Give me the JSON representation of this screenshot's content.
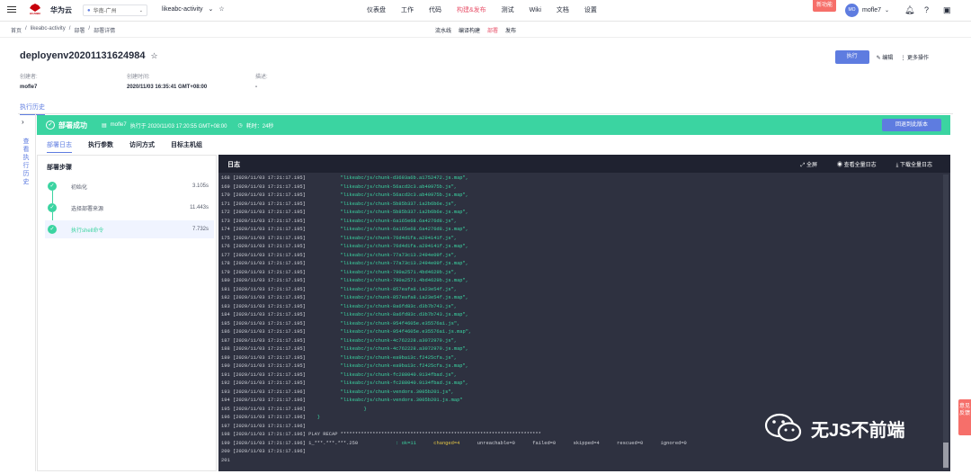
{
  "topbar": {
    "brand": "华为云",
    "logo_text": "HUAWEI",
    "region": "华南-广州",
    "project": "likeabc-activity",
    "nav": [
      "仪表盘",
      "工作",
      "代码",
      "构建&发布",
      "测试",
      "Wiki",
      "文档",
      "设置"
    ],
    "active_nav": 3,
    "new_badge": "新功能",
    "user_initials": "MO",
    "user": "mofle7"
  },
  "subnav": {
    "breadcrumb": [
      "首页",
      "/",
      "likeabc-activity",
      "/",
      "部署",
      "/",
      "部署详情"
    ],
    "tabs": [
      "流水线",
      "编译构建",
      "部署",
      "发布"
    ],
    "active_tab": 2
  },
  "page": {
    "title": "deployenv20201131624984",
    "run_label": "执行",
    "edit_label": "编辑",
    "more_label": "更多操作",
    "meta": [
      {
        "k": "创建者:",
        "v": "mofle7"
      },
      {
        "k": "创建时间:",
        "v": "2020/11/03 16:35:41 GMT+08:00"
      },
      {
        "k": "描述:",
        "v": "-"
      }
    ],
    "history_tab": "执行历史",
    "side_label": "查看执行历史"
  },
  "banner": {
    "status": "部署成功",
    "user": "mofle7",
    "exec_text": "执行于 2020/11/03 17:20:55 GMT+08:00",
    "duration": "耗时：24秒",
    "rollback": "回退到此版本"
  },
  "subtabs": [
    "部署日志",
    "执行参数",
    "访问方式",
    "目标主机组"
  ],
  "steps": {
    "title": "部署步骤",
    "items": [
      {
        "name": "初始化",
        "time": "3.105s"
      },
      {
        "name": "选择部署来源",
        "time": "11.443s"
      },
      {
        "name": "执行shell命令",
        "time": "7.732s"
      }
    ],
    "selected": 2
  },
  "log": {
    "title": "日志",
    "ops": [
      "全屏",
      "查看全量日志",
      "下载全量日志"
    ],
    "lines": [
      {
        "n": "168",
        "ts": "[2020/11/03 17:21:17.195]",
        "text": "\"likeabc/js/chunk-d3693a6b.a1752472.js.map\","
      },
      {
        "n": "169",
        "ts": "[2020/11/03 17:21:17.195]",
        "text": "\"likeabc/js/chunk-56acd2c3.ab40975b.js\","
      },
      {
        "n": "170",
        "ts": "[2020/11/03 17:21:17.195]",
        "text": "\"likeabc/js/chunk-56acd2c3.ab40975b.js.map\","
      },
      {
        "n": "171",
        "ts": "[2020/11/03 17:21:17.195]",
        "text": "\"likeabc/js/chunk-5b85b337.1a2b6b6e.js\","
      },
      {
        "n": "172",
        "ts": "[2020/11/03 17:21:17.195]",
        "text": "\"likeabc/js/chunk-5b85b337.1a2b6b6e.js.map\","
      },
      {
        "n": "173",
        "ts": "[2020/11/03 17:21:17.195]",
        "text": "\"likeabc/js/chunk-6a165e68.6a4276d8.js\","
      },
      {
        "n": "174",
        "ts": "[2020/11/03 17:21:17.195]",
        "text": "\"likeabc/js/chunk-6a165e68.6a4276d8.js.map\","
      },
      {
        "n": "175",
        "ts": "[2020/11/03 17:21:17.195]",
        "text": "\"likeabc/js/chunk-76d4d1fa.a294141f.js\","
      },
      {
        "n": "176",
        "ts": "[2020/11/03 17:21:17.195]",
        "text": "\"likeabc/js/chunk-76d4d1fa.a294141f.js.map\","
      },
      {
        "n": "177",
        "ts": "[2020/11/03 17:21:17.195]",
        "text": "\"likeabc/js/chunk-77a73c13.2494e09f.js\","
      },
      {
        "n": "178",
        "ts": "[2020/11/03 17:21:17.195]",
        "text": "\"likeabc/js/chunk-77a73c13.2494e09f.js.map\","
      },
      {
        "n": "179",
        "ts": "[2020/11/03 17:21:17.195]",
        "text": "\"likeabc/js/chunk-790a2571.4bd4629b.js\","
      },
      {
        "n": "180",
        "ts": "[2020/11/03 17:21:17.195]",
        "text": "\"likeabc/js/chunk-790a2571.4bd4629b.js.map\","
      },
      {
        "n": "181",
        "ts": "[2020/11/03 17:21:17.195]",
        "text": "\"likeabc/js/chunk-857eafa8.1a23e54f.js\","
      },
      {
        "n": "182",
        "ts": "[2020/11/03 17:21:17.195]",
        "text": "\"likeabc/js/chunk-857eafa8.1a23e54f.js.map\","
      },
      {
        "n": "183",
        "ts": "[2020/11/03 17:21:17.195]",
        "text": "\"likeabc/js/chunk-8a6fd83c.d3b7b743.js\","
      },
      {
        "n": "184",
        "ts": "[2020/11/03 17:21:17.195]",
        "text": "\"likeabc/js/chunk-8a6fd83c.d3b7b743.js.map\","
      },
      {
        "n": "185",
        "ts": "[2020/11/03 17:21:17.195]",
        "text": "\"likeabc/js/chunk-954f4605e.e35576a1.js\","
      },
      {
        "n": "186",
        "ts": "[2020/11/03 17:21:17.195]",
        "text": "\"likeabc/js/chunk-954f4605e.e35576a1.js.map\","
      },
      {
        "n": "187",
        "ts": "[2020/11/03 17:21:17.195]",
        "text": "\"likeabc/js/chunk-4c762228.a3072979.js\","
      },
      {
        "n": "188",
        "ts": "[2020/11/03 17:21:17.195]",
        "text": "\"likeabc/js/chunk-4c762228.a3072979.js.map\","
      },
      {
        "n": "189",
        "ts": "[2020/11/03 17:21:17.195]",
        "text": "\"likeabc/js/chunk-ea9ba13c.f2425cfa.js\","
      },
      {
        "n": "190",
        "ts": "[2020/11/03 17:21:17.195]",
        "text": "\"likeabc/js/chunk-ea9ba13c.f2425cfa.js.map\","
      },
      {
        "n": "191",
        "ts": "[2020/11/03 17:21:17.195]",
        "text": "\"likeabc/js/chunk-fc288040.9134fbad.js\","
      },
      {
        "n": "192",
        "ts": "[2020/11/03 17:21:17.195]",
        "text": "\"likeabc/js/chunk-fc288040.9134fbad.js.map\","
      },
      {
        "n": "193",
        "ts": "[2020/11/03 17:21:17.196]",
        "text": "\"likeabc/js/chunk-vendors.3005b201.js\","
      },
      {
        "n": "194",
        "ts": "[2020/11/03 17:21:17.196]",
        "text": "\"likeabc/js/chunk-vendors.3005b201.js.map\""
      },
      {
        "n": "195",
        "ts": "[2020/11/03 17:21:17.196]",
        "text": "}",
        "indent": 1
      },
      {
        "n": "196",
        "ts": "[2020/11/03 17:21:17.196]",
        "text": "}",
        "indent": 2
      },
      {
        "n": "197",
        "ts": "[2020/11/03 17:21:17.196]",
        "text": ""
      },
      {
        "n": "198",
        "ts": "[2020/11/03 17:21:17.196]",
        "text": "PLAY RECAP *********************************************************************",
        "white": true
      },
      {
        "n": "199",
        "ts": "[2020/11/03 17:21:17.196]",
        "text": "1_***.***.***.250",
        "white": true,
        "recap": [
          {
            "t": ": ok=11",
            "c": "gr"
          },
          {
            "t": "changed=4",
            "c": "yl"
          },
          {
            "t": "unreachable=0",
            "c": "ln"
          },
          {
            "t": "failed=0",
            "c": "ln"
          },
          {
            "t": "skipped=4",
            "c": "ln"
          },
          {
            "t": "rescued=0",
            "c": "ln"
          },
          {
            "t": "ignored=0",
            "c": "ln"
          }
        ]
      },
      {
        "n": "200",
        "ts": "[2020/11/03 17:21:17.196]",
        "text": ""
      },
      {
        "n": "201",
        "ts": "",
        "text": ""
      }
    ]
  },
  "watermark": "无JS不前端",
  "feedback": "意见反馈",
  "colors": {
    "accent": "#5e7ce0",
    "success": "#3bd4a1",
    "nav_active": "#e8546c",
    "log_bg": "#2e3140"
  }
}
